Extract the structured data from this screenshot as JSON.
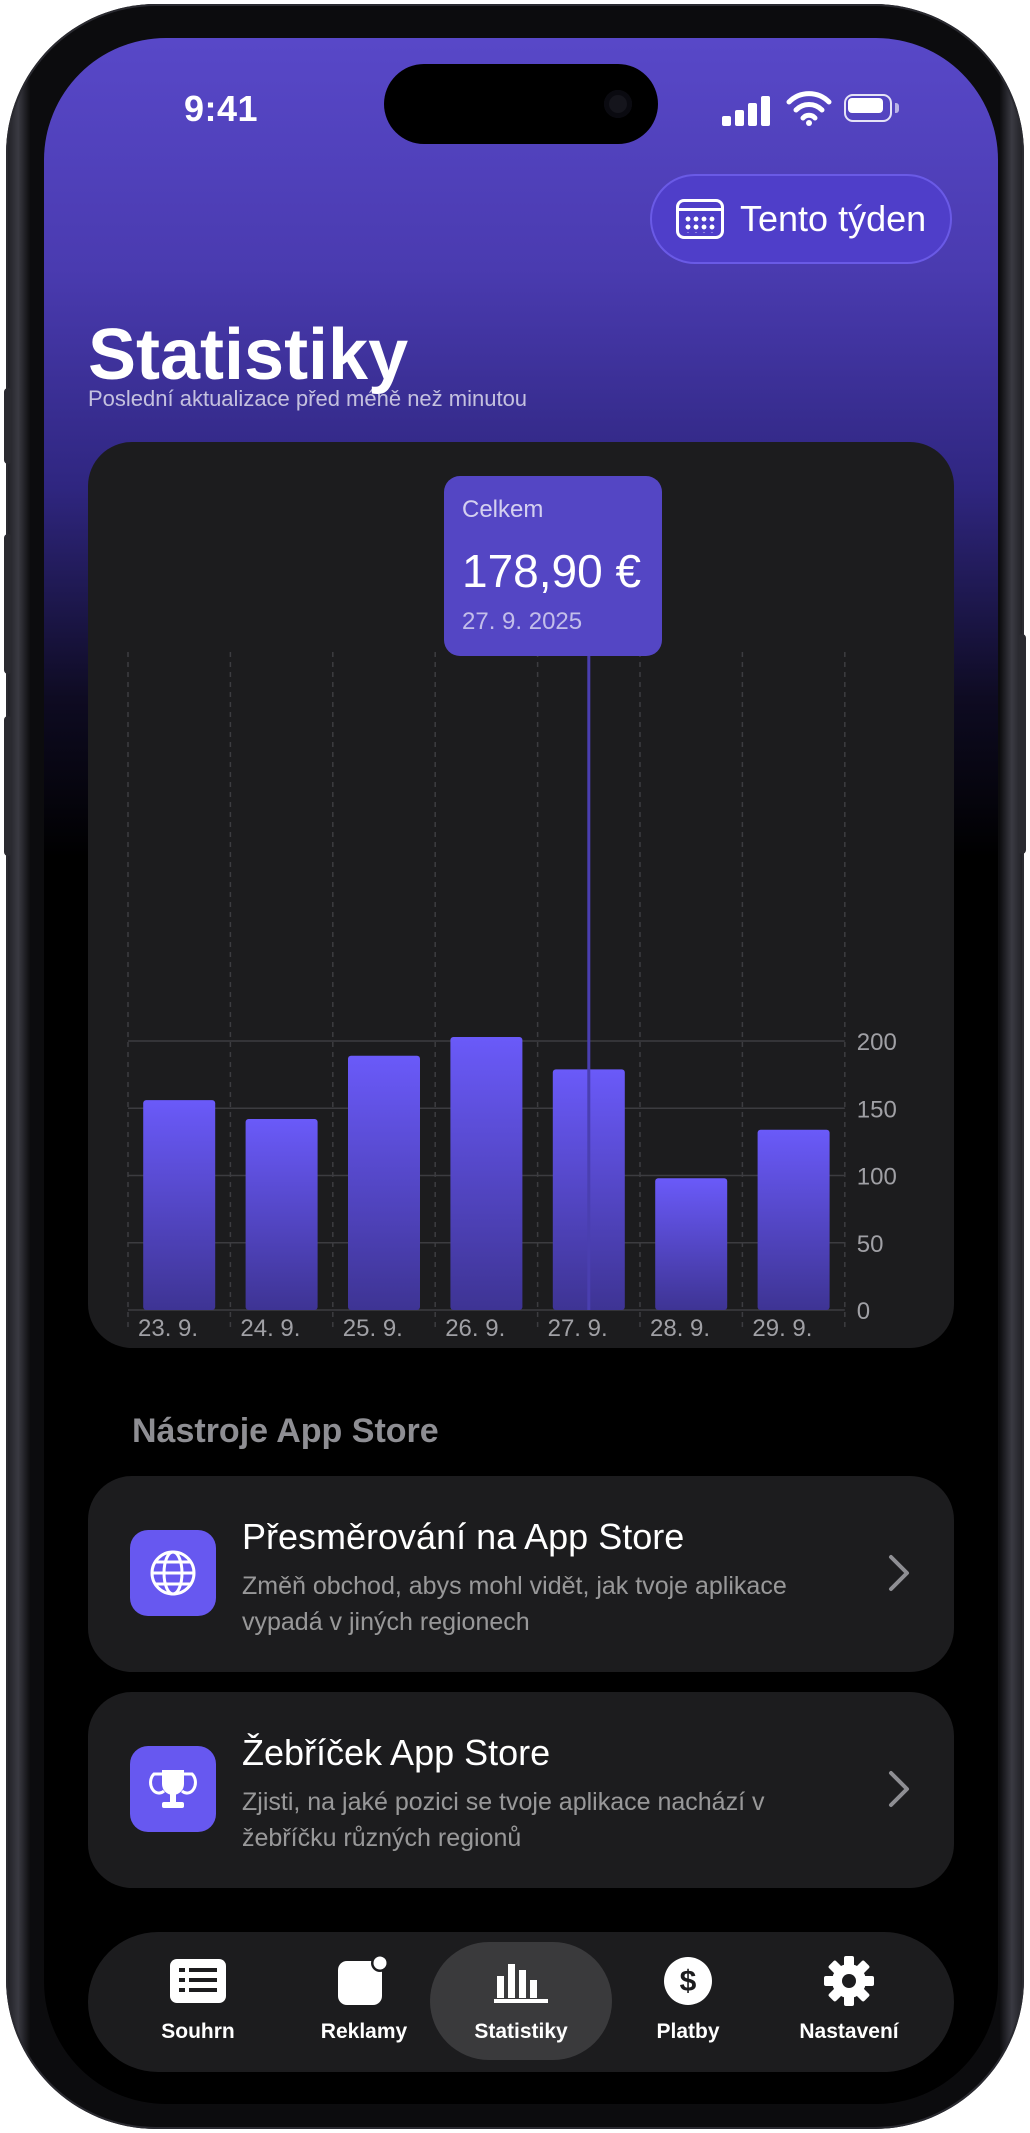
{
  "status_bar": {
    "time": "9:41"
  },
  "header": {
    "period_button": "Tento týden",
    "title": "Statistiky",
    "subtitle": "Poslední aktualizace před méně než minutou"
  },
  "tooltip": {
    "label": "Celkem",
    "value": "178,90 €",
    "date": "27. 9. 2025"
  },
  "chart_data": {
    "type": "bar",
    "categories": [
      "23. 9.",
      "24. 9.",
      "25. 9.",
      "26. 9.",
      "27. 9.",
      "28. 9.",
      "29. 9."
    ],
    "values": [
      156,
      142,
      189,
      203,
      178.9,
      98,
      134
    ],
    "selected_index": 4,
    "ylim": [
      0,
      225
    ],
    "yticks": [
      0,
      50,
      100,
      150,
      200
    ],
    "y_axis_position": "right",
    "grid": true,
    "bar_color_top": "#6a5af9",
    "bar_color_bottom": "#3e3494"
  },
  "tools": {
    "section_title": "Nástroje App Store",
    "items": [
      {
        "icon": "globe-icon",
        "title": "Přesměrování na App Store",
        "desc": "Změň obchod, abys mohl vidět, jak tvoje aplikace vypadá v jiných regionech"
      },
      {
        "icon": "trophy-icon",
        "title": "Žebříček App Store",
        "desc": "Zjisti, na jaké pozici se tvoje aplikace nachází v žebříčku různých regionů"
      }
    ]
  },
  "tabbar": {
    "items": [
      {
        "label": "Souhrn",
        "icon": "list-icon"
      },
      {
        "label": "Reklamy",
        "icon": "ads-icon"
      },
      {
        "label": "Statistiky",
        "icon": "chart-icon",
        "active": true
      },
      {
        "label": "Platby",
        "icon": "dollar-icon"
      },
      {
        "label": "Nastavení",
        "icon": "gear-icon"
      }
    ]
  },
  "colors": {
    "accent": "#6758f0",
    "card": "#1c1c1e",
    "tooltip": "#5446c4"
  }
}
